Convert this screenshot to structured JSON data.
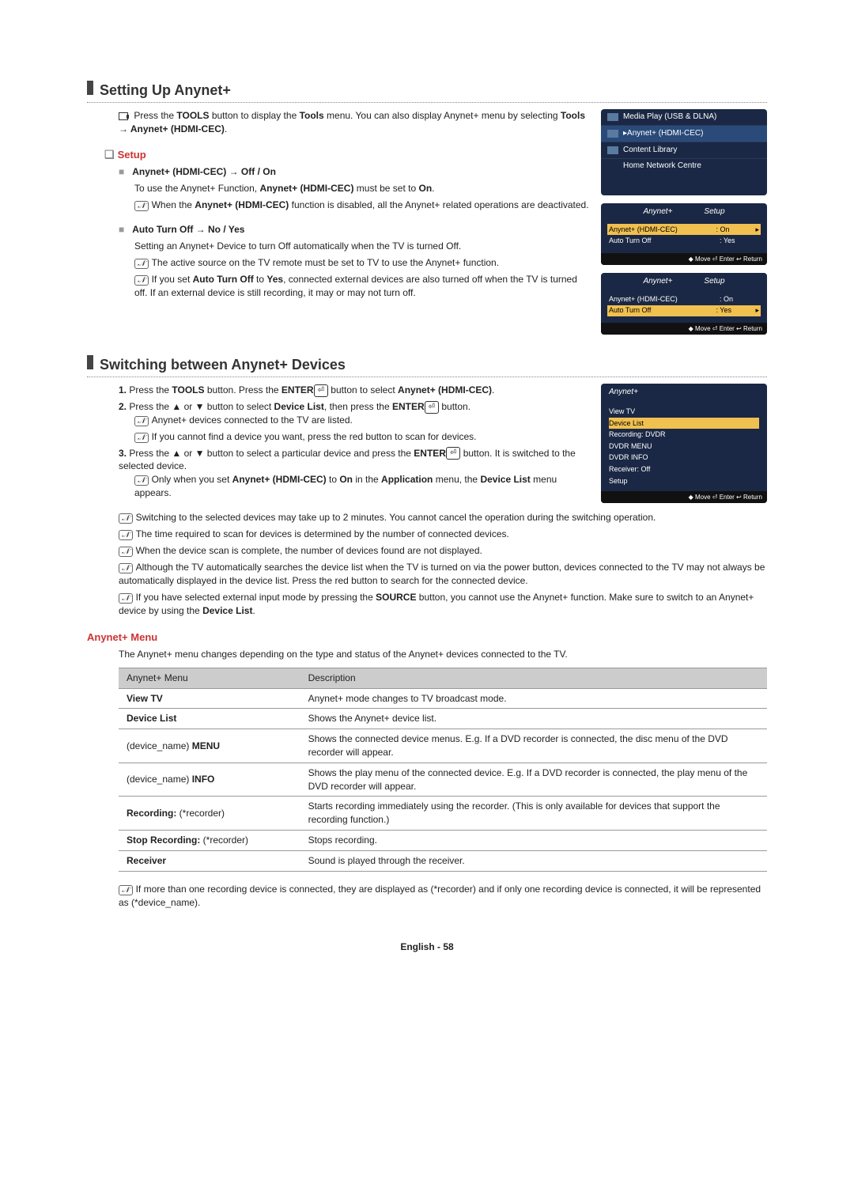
{
  "headings": {
    "setting_up": "Setting Up Anynet+",
    "switching": "Switching between Anynet+ Devices"
  },
  "subheads": {
    "setup": "Setup",
    "anynet_menu": "Anynet+ Menu"
  },
  "text": {
    "tools_intro_a": "Press the ",
    "tools_intro_b": " button to display the ",
    "tools_intro_c": " menu. You can also display Anynet+ menu by selecting ",
    "tools": "TOOLS",
    "tools_word": "Tools",
    "tools_path": "Tools → Anynet+ (HDMI-CEC)",
    "hdmi_onoff": "Anynet+ (HDMI-CEC) → Off / On",
    "hdmi_use_a": "To use the Anynet+ Function, ",
    "hdmi_use_b": " must be set to ",
    "hdmi_cec": "Anynet+ (HDMI-CEC)",
    "on": "On",
    "hdmi_note_a": "When the ",
    "hdmi_note_b": " function is disabled, all the Anynet+ related operations are deactivated.",
    "auto_off": "Auto Turn Off → No / Yes",
    "auto_off_desc": "Setting an Anynet+ Device to turn Off automatically when the TV is turned Off.",
    "auto_note1": "The active source on the TV remote must be set to TV to use the Anynet+ function.",
    "auto_note2_a": "If you set ",
    "auto_note2_b": " to ",
    "auto_turn_off": "Auto Turn Off",
    "yes": "Yes",
    "auto_note2_c": ", connected external devices are also turned off when the TV is turned off. If an external device is still recording, it may or may not turn off.",
    "sw1_a": "Press the ",
    "sw1_b": " button. Press the ",
    "sw1_c": " button to select ",
    "enter": "ENTER",
    "sw2_a": "Press the ▲ or ▼ button to select ",
    "device_list": "Device List",
    "sw2_b": ", then press the ",
    "sw2_c": " button.",
    "sw2_n1": "Anynet+ devices connected to the TV are listed.",
    "sw2_n2": "If you cannot find a device you want, press the red button to scan for devices.",
    "sw3_a": "Press the ▲ or ▼ button to select a particular device and press the ",
    "sw3_b": " button. It is switched to the selected device.",
    "sw3_n1_a": "Only when you set ",
    "sw3_n1_b": " to ",
    "sw3_n1_c": " in the ",
    "application": "Application",
    "sw3_n1_d": " menu, the ",
    "sw3_n1_e": " menu appears.",
    "gn1": "Switching to the selected devices may take up to 2 minutes. You cannot cancel the operation during the switching operation.",
    "gn2": "The time required to scan for devices is determined by the number of connected devices.",
    "gn3": "When the device scan is complete, the number of devices found are not displayed.",
    "gn4": "Although the TV automatically searches the device list when the TV is turned on via the power button, devices connected to the TV may not always be automatically displayed in the device list. Press the red button to search for the connected device.",
    "gn5_a": "If you have selected external input mode by pressing the ",
    "source": "SOURCE",
    "gn5_b": " button, you cannot use the Anynet+ function. Make sure to switch to an Anynet+ device by using the ",
    "am_desc": "The Anynet+ menu changes depending on the type and status of the Anynet+ devices connected to the TV.",
    "tbl_h1": "Anynet+ Menu",
    "tbl_h2": "Description",
    "r1a": "View TV",
    "r1b": "Anynet+ mode changes to TV broadcast mode.",
    "r2a": "Device List",
    "r2b": "Shows the Anynet+ device list.",
    "r3a": "(device_name) MENU",
    "r3b": "Shows the connected device menus. E.g. If a DVD recorder is connected, the disc menu of the DVD recorder will appear.",
    "r4a": "(device_name) INFO",
    "r4b": "Shows the play menu of the connected device. E.g. If a DVD recorder is connected, the play menu of the DVD recorder will appear.",
    "r5a": "Recording: (*recorder)",
    "r5b": "Starts recording immediately using the recorder. (This is only available for devices that support the recording function.)",
    "r6a": "Stop Recording: (*recorder)",
    "r6b": "Stops recording.",
    "r7a": "Receiver",
    "r7b": "Sound is played through the receiver.",
    "final_note": "If more than one recording device is connected, they are displayed as (*recorder) and if only one recording device is connected, it will be represented as (*device_name).",
    "footer": "English - 58"
  },
  "osd": {
    "app_menu": [
      "Media Play (USB & DLNA)",
      "Anynet+ (HDMI-CEC)",
      "Content Library",
      "Home Network Centre"
    ],
    "setup_title": "Setup",
    "setup_r1a": "Anynet+ (HDMI-CEC)",
    "setup_r1b": ": On",
    "setup_r2a": "Auto Turn Off",
    "setup_r2b": ": Yes",
    "foot": "◆ Move    ⏎ Enter    ↩ Return",
    "anynet_title": "Anynet+",
    "dl": [
      "View TV",
      "Device List",
      "Recording: DVDR",
      "DVDR MENU",
      "DVDR INFO",
      "Receiver: Off",
      "Setup"
    ]
  },
  "nums": {
    "n1": "1.",
    "n2": "2.",
    "n3": "3."
  }
}
